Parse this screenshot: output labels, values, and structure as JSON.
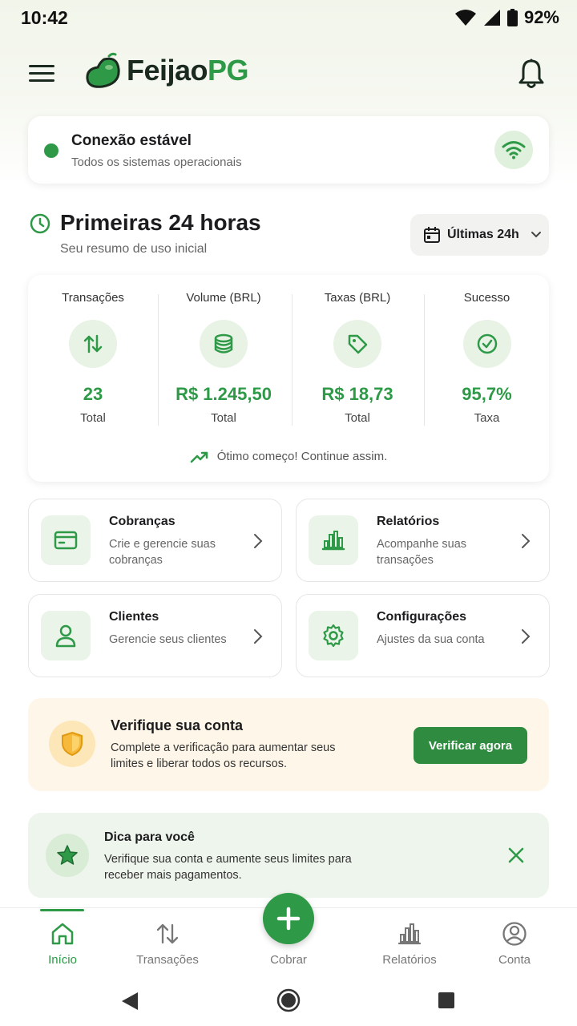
{
  "status_bar": {
    "time": "10:42",
    "battery": "92%"
  },
  "app": {
    "logo_part1": "Feijao",
    "logo_part2": "PG"
  },
  "colors": {
    "primary": "#2e9a47",
    "warning_bg": "#fef7e9",
    "tip_bg": "#eef5ec"
  },
  "connection": {
    "title": "Conexão estável",
    "subtitle": "Todos os sistemas operacionais"
  },
  "summary": {
    "title": "Primeiras 24 horas",
    "subtitle": "Seu resumo de uso inicial",
    "range_label": "Últimas 24h"
  },
  "stats": [
    {
      "label": "Transações",
      "value": "23",
      "caption": "Total",
      "icon": "arrows-updown-icon"
    },
    {
      "label": "Volume (BRL)",
      "value": "R$ 1.245,50",
      "caption": "Total",
      "icon": "coins-icon"
    },
    {
      "label": "Taxas (BRL)",
      "value": "R$ 18,73",
      "caption": "Total",
      "icon": "tag-icon"
    },
    {
      "label": "Sucesso",
      "value": "95,7%",
      "caption": "Taxa",
      "icon": "check-circle-icon"
    }
  ],
  "stats_footer": "Ótimo começo! Continue assim.",
  "actions": [
    {
      "title": "Cobranças",
      "desc": "Crie e gerencie suas cobranças"
    },
    {
      "title": "Relatórios",
      "desc": "Acompanhe suas transações"
    },
    {
      "title": "Clientes",
      "desc": "Gerencie seus clientes"
    },
    {
      "title": "Configurações",
      "desc": "Ajustes da sua conta"
    }
  ],
  "verify": {
    "title": "Verifique sua conta",
    "desc": "Complete a verificação para aumentar seus limites e liberar todos os recursos.",
    "button": "Verificar agora"
  },
  "tip": {
    "title": "Dica para você",
    "desc": "Verifique sua conta e aumente seus limites para receber mais pagamentos."
  },
  "nav": {
    "home": "Início",
    "transactions": "Transações",
    "charge": "Cobrar",
    "reports": "Relatórios",
    "account": "Conta"
  }
}
